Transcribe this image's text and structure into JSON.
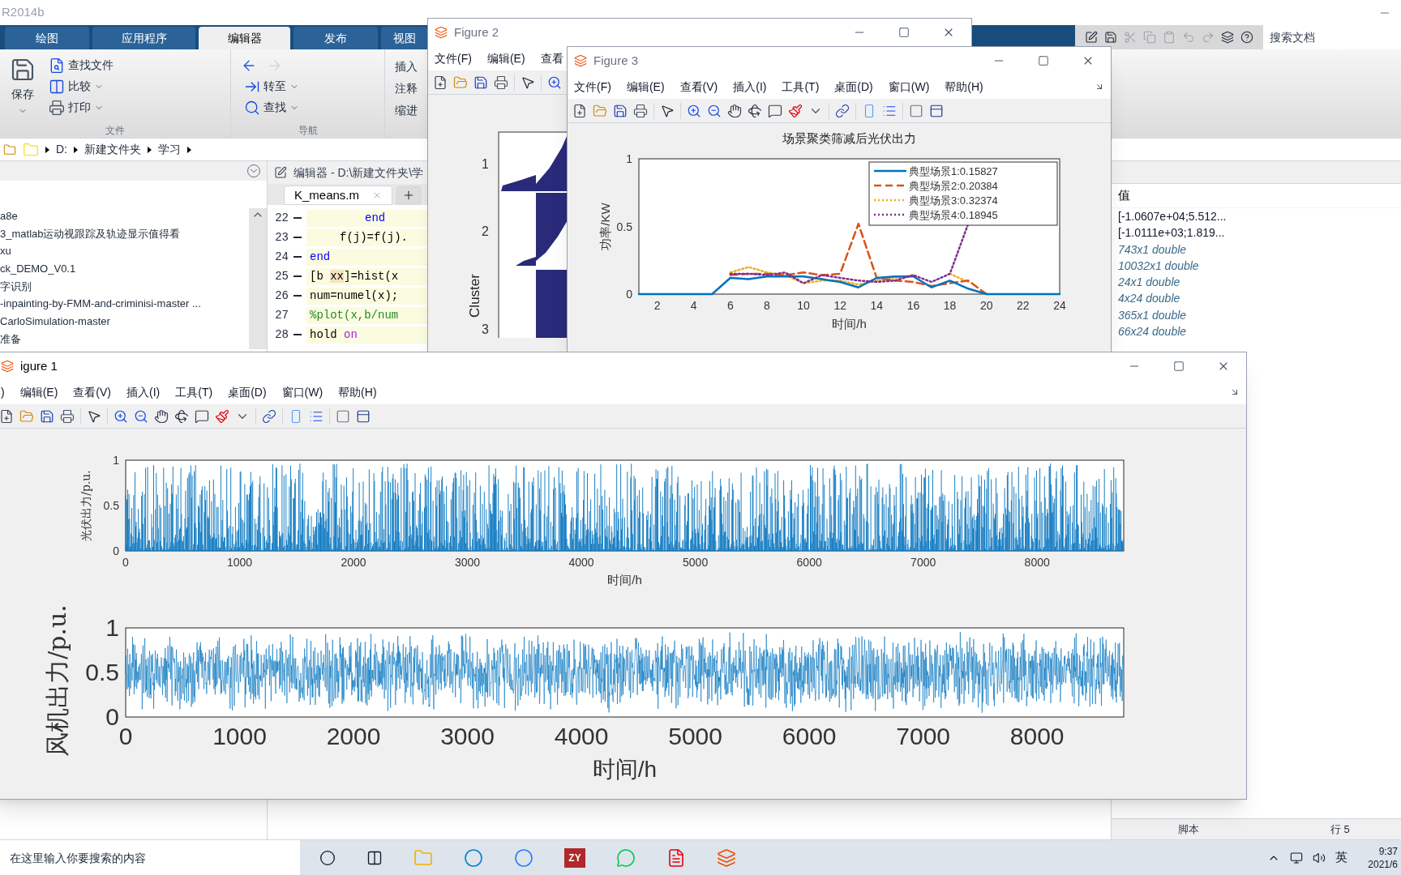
{
  "matlab": {
    "title": "R2014b",
    "tabs": [
      {
        "label": "绘图",
        "selected": false
      },
      {
        "label": "应用程序",
        "selected": false
      },
      {
        "label": "编辑器",
        "selected": true
      },
      {
        "label": "发布",
        "selected": false
      },
      {
        "label": "视图",
        "selected": false
      }
    ],
    "search": {
      "placeholder": "搜索文档"
    },
    "ribbon": {
      "file": {
        "label": "文件",
        "save": "保存",
        "find_files": "查找文件",
        "compare": "比较",
        "print": "打印"
      },
      "navigate": {
        "label": "导航",
        "go_to": "转至",
        "find": "查找"
      },
      "edit": {
        "insert": "插入",
        "comment": "注释",
        "indent": "缩进"
      }
    },
    "path": [
      "D:",
      "新建文件夹",
      "学习"
    ],
    "files": [
      "a8e",
      "3_matlab运动视跟踪及轨迹显示值得看",
      "xu",
      "ck_DEMO_V0.1",
      "字识别",
      "-inpainting-by-FMM-and-criminisi-master ...",
      "CarloSimulation-master",
      "准备"
    ],
    "editor": {
      "title": "编辑器 - D:\\新建文件夹\\学",
      "tab": "K_means.m",
      "lines": [
        {
          "number": "22",
          "executable": true,
          "segments": [
            {
              "text": "end",
              "kind": "keyword"
            }
          ]
        },
        {
          "number": "23",
          "executable": true,
          "segments": [
            {
              "text": "f(j)=f(j).",
              "kind": "plain"
            }
          ]
        },
        {
          "number": "24",
          "executable": true,
          "segments": [
            {
              "text": "end",
              "kind": "keyword"
            }
          ]
        },
        {
          "number": "25",
          "executable": true,
          "segments": [
            {
              "text": "[b ",
              "kind": "plain"
            },
            {
              "text": "xx",
              "kind": "highlight"
            },
            {
              "text": "]=hist(x",
              "kind": "plain"
            }
          ]
        },
        {
          "number": "26",
          "executable": true,
          "segments": [
            {
              "text": "num=numel(x);",
              "kind": "plain"
            }
          ]
        },
        {
          "number": "27",
          "executable": false,
          "segments": [
            {
              "text": "%plot(x,b/num",
              "kind": "comment"
            }
          ]
        },
        {
          "number": "28",
          "executable": true,
          "segments": [
            {
              "text": "hold ",
              "kind": "plain"
            },
            {
              "text": "on",
              "kind": "string"
            }
          ]
        }
      ]
    },
    "workspace": {
      "column": "值",
      "values": [
        {
          "text": "[-1.0607e+04;5.512...",
          "kind": "value"
        },
        {
          "text": "[-1.0111e+03;1.819...",
          "kind": "value"
        },
        {
          "text": "743x1 double",
          "kind": "size"
        },
        {
          "text": "10032x1 double",
          "kind": "size"
        },
        {
          "text": "24x1 double",
          "kind": "size"
        },
        {
          "text": "4x24 double",
          "kind": "size"
        },
        {
          "text": "365x1 double",
          "kind": "size"
        },
        {
          "text": "66x24 double",
          "kind": "size"
        }
      ]
    },
    "status": {
      "mode": "脚本",
      "line": "行 5"
    }
  },
  "figure2": {
    "title": "Figure 2",
    "menus": [
      "文件(F)",
      "编辑(E)",
      "查看"
    ],
    "plot": {
      "ylabel": "Cluster",
      "yticks": [
        "1",
        "2",
        "3"
      ]
    }
  },
  "figure3": {
    "title": "Figure 3",
    "menus": [
      "文件(F)",
      "编辑(E)",
      "查看(V)",
      "插入(I)",
      "工具(T)",
      "桌面(D)",
      "窗口(W)",
      "帮助(H)"
    ],
    "chart_data": {
      "type": "line",
      "title": "场景聚类筛减后光伏出力",
      "xlabel": "时间/h",
      "ylabel": "功率/KW",
      "x": [
        1,
        2,
        3,
        4,
        5,
        6,
        7,
        8,
        9,
        10,
        11,
        12,
        13,
        14,
        15,
        16,
        17,
        18,
        19,
        20,
        21,
        22,
        23,
        24
      ],
      "series": [
        {
          "name": "典型场景1:0.15827",
          "color": "#0072bd",
          "line_style": "solid",
          "values": [
            0,
            0,
            0,
            0,
            0,
            0.12,
            0.11,
            0.13,
            0.13,
            0.13,
            0.11,
            0.09,
            0.05,
            0.12,
            0.13,
            0.13,
            0.05,
            0.1,
            0.04,
            0,
            0,
            0,
            0,
            0
          ]
        },
        {
          "name": "典型场景2:0.20384",
          "color": "#d95319",
          "line_style": "dashed",
          "values": [
            null,
            null,
            null,
            null,
            null,
            0.14,
            0.15,
            0.15,
            0.14,
            0.16,
            0.14,
            0.15,
            0.52,
            0.12,
            0.1,
            0.09,
            0.06,
            0.08,
            0.1,
            0,
            null,
            null,
            null,
            null
          ]
        },
        {
          "name": "典型场景3:0.32374",
          "color": "#edb120",
          "line_style": "dotted",
          "values": [
            null,
            null,
            null,
            null,
            null,
            0.16,
            0.2,
            0.16,
            0.14,
            0.08,
            0.1,
            0.1,
            0.07,
            0.1,
            0.12,
            0.14,
            null,
            0.15,
            0.09,
            null,
            null,
            null,
            null,
            null
          ]
        },
        {
          "name": "典型场景4:0.18945",
          "color": "#7e2f8e",
          "line_style": "dotted",
          "values": [
            null,
            null,
            null,
            null,
            null,
            0.15,
            0.15,
            0.14,
            0.16,
            0.08,
            0.14,
            0.12,
            0.1,
            0.09,
            0.1,
            0.14,
            0.09,
            0.15,
            0.52,
            null,
            null,
            null,
            null,
            null
          ]
        }
      ],
      "legend": true,
      "xlim": [
        1,
        24
      ],
      "ylim": [
        0,
        1
      ],
      "xticks": [
        2,
        4,
        6,
        8,
        10,
        12,
        14,
        16,
        18,
        20,
        22,
        24
      ],
      "yticks": [
        0,
        0.5,
        1
      ]
    }
  },
  "figure1": {
    "title": "igure 1",
    "menus": [
      ")",
      "编辑(E)",
      "查看(V)",
      "插入(I)",
      "工具(T)",
      "桌面(D)",
      "窗口(W)",
      "帮助(H)"
    ],
    "plots": [
      {
        "kind": "pv",
        "ylabel": "光伏出力/p.u.",
        "xlabel": "时间/h",
        "yticks": [
          "1",
          "0.5",
          "0"
        ],
        "xticks": [
          "0",
          "1000",
          "2000",
          "3000",
          "4000",
          "5000",
          "6000",
          "7000",
          "8000"
        ]
      },
      {
        "kind": "wind",
        "ylabel": "风机出力/p.u.",
        "xlabel": "时间/h",
        "yticks": [
          "1",
          "0.5",
          "0"
        ],
        "xticks": [
          "0",
          "1000",
          "2000",
          "3000",
          "4000",
          "5000",
          "6000",
          "7000",
          "8000"
        ]
      }
    ]
  },
  "taskbar": {
    "search": {
      "placeholder": "在这里输入你要搜索的内容"
    },
    "app_label": "ZY",
    "ime": "英",
    "time": "9:37",
    "date": "2021/6"
  }
}
